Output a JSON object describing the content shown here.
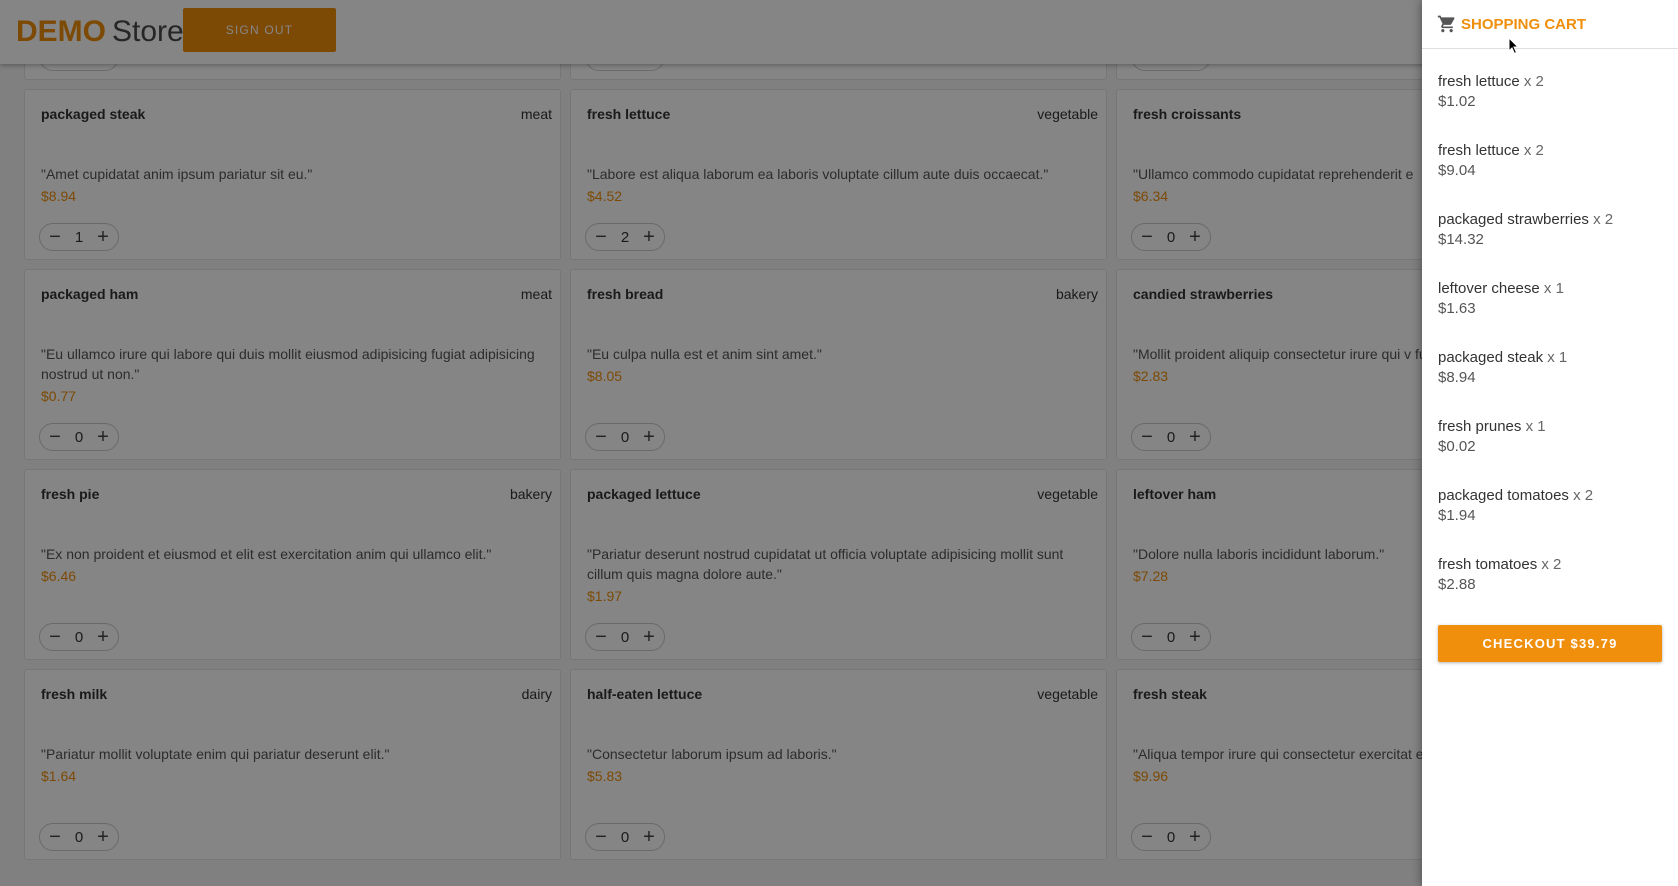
{
  "header": {
    "logo_bold": "DEMO",
    "logo_light": "Store",
    "sign_out": "SIGN OUT"
  },
  "products": [
    {
      "name": "",
      "category": "",
      "description": "",
      "price": "",
      "qty": ""
    },
    {
      "name": "",
      "category": "",
      "description": "",
      "price": "",
      "qty": ""
    },
    {
      "name": "",
      "category": "",
      "description": "",
      "price": "",
      "qty": ""
    },
    {
      "name": "packaged steak",
      "category": "meat",
      "description": "\"Amet cupidatat anim ipsum pariatur sit eu.\"",
      "price": "$8.94",
      "qty": "1"
    },
    {
      "name": "fresh lettuce",
      "category": "vegetable",
      "description": "\"Labore est aliqua laborum ea laboris voluptate cillum aute duis occaecat.\"",
      "price": "$4.52",
      "qty": "2"
    },
    {
      "name": "fresh croissants",
      "category": "",
      "description": "\"Ullamco commodo cupidatat reprehenderit e",
      "price": "$6.34",
      "qty": "0"
    },
    {
      "name": "packaged ham",
      "category": "meat",
      "description": "\"Eu ullamco irure qui labore qui duis mollit eiusmod adipisicing fugiat adipisicing nostrud ut non.\"",
      "price": "$0.77",
      "qty": "0"
    },
    {
      "name": "fresh bread",
      "category": "bakery",
      "description": "\"Eu culpa nulla est et anim sint amet.\"",
      "price": "$8.05",
      "qty": "0"
    },
    {
      "name": "candied strawberries",
      "category": "",
      "description": "\"Mollit proident aliquip consectetur irure qui v fugiat esse nulla.\"",
      "price": "$2.83",
      "qty": "0"
    },
    {
      "name": "fresh pie",
      "category": "bakery",
      "description": "\"Ex non proident et eiusmod et elit est exercitation anim qui ullamco elit.\"",
      "price": "$6.46",
      "qty": "0"
    },
    {
      "name": "packaged lettuce",
      "category": "vegetable",
      "description": "\"Pariatur deserunt nostrud cupidatat ut officia voluptate adipisicing mollit sunt cillum quis magna dolore aute.\"",
      "price": "$1.97",
      "qty": "0"
    },
    {
      "name": "leftover ham",
      "category": "",
      "description": "\"Dolore nulla laboris incididunt laborum.\"",
      "price": "$7.28",
      "qty": "0"
    },
    {
      "name": "fresh milk",
      "category": "dairy",
      "description": "\"Pariatur mollit voluptate enim qui pariatur deserunt elit.\"",
      "price": "$1.64",
      "qty": "0"
    },
    {
      "name": "half-eaten lettuce",
      "category": "vegetable",
      "description": "\"Consectetur laborum ipsum ad laboris.\"",
      "price": "$5.83",
      "qty": "0"
    },
    {
      "name": "fresh steak",
      "category": "",
      "description": "\"Aliqua tempor irure qui consectetur exercitat ex pariatur elit culpa.\"",
      "price": "$9.96",
      "qty": "0"
    }
  ],
  "cart": {
    "title": "SHOPPING CART",
    "items": [
      {
        "name": "fresh lettuce",
        "qty": "x 2",
        "price": "$1.02"
      },
      {
        "name": "fresh lettuce",
        "qty": "x 2",
        "price": "$9.04"
      },
      {
        "name": "packaged strawberries",
        "qty": "x 2",
        "price": "$14.32"
      },
      {
        "name": "leftover cheese",
        "qty": "x 1",
        "price": "$1.63"
      },
      {
        "name": "packaged steak",
        "qty": "x 1",
        "price": "$8.94"
      },
      {
        "name": "fresh prunes",
        "qty": "x 1",
        "price": "$0.02"
      },
      {
        "name": "packaged tomatoes",
        "qty": "x 2",
        "price": "$1.94"
      },
      {
        "name": "fresh tomatoes",
        "qty": "x 2",
        "price": "$2.88"
      }
    ],
    "checkout": "CHECKOUT $39.79"
  },
  "icons": {
    "cart": "shopping-cart-icon",
    "minus": "−",
    "plus": "+"
  },
  "colors": {
    "accent": "#ef8f0c"
  }
}
